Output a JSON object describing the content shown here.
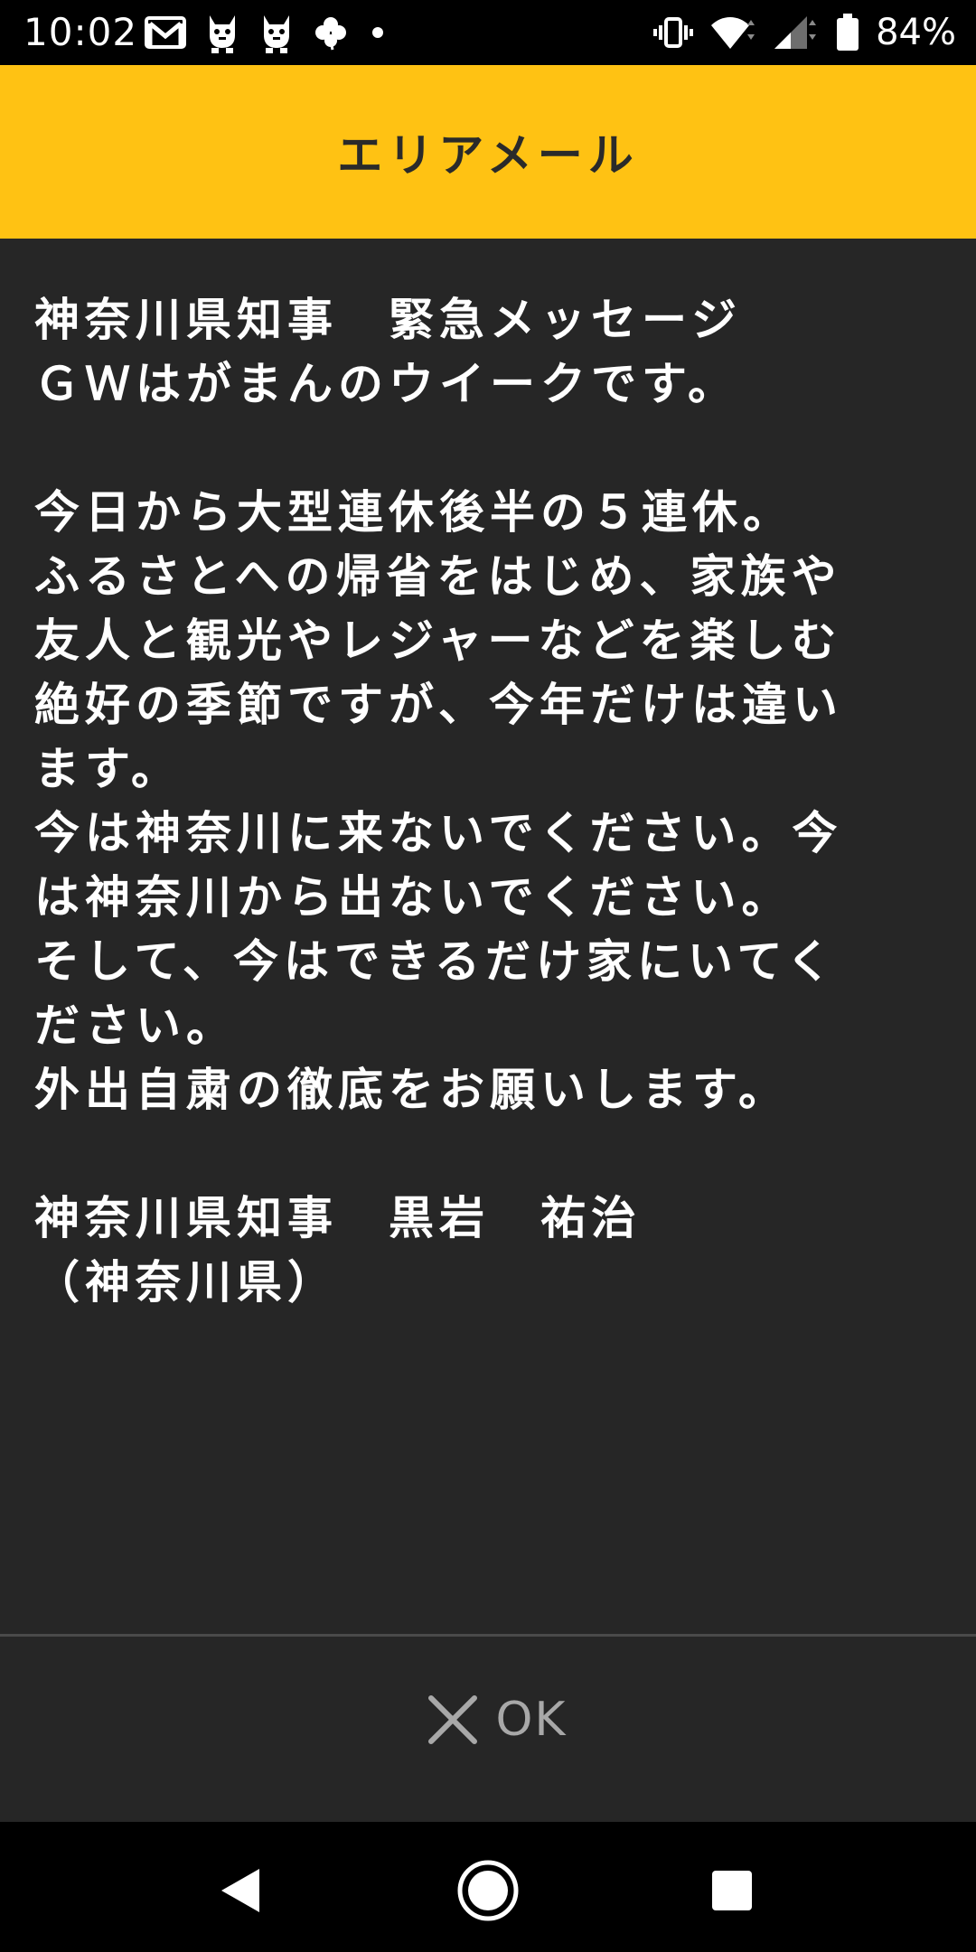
{
  "status_bar": {
    "time": "10:02",
    "left_icons": [
      "gmail-icon",
      "mascot-icon",
      "mascot-icon",
      "clover-icon",
      "dot-icon"
    ],
    "right_icons": [
      "vibrate-icon",
      "wifi-icon",
      "signal-icon",
      "battery-icon"
    ],
    "battery_percent": "84%"
  },
  "header": {
    "title": "エリアメール",
    "background_color": "#ffc213"
  },
  "message": {
    "body": "神奈川県知事　緊急メッセージ\nＧＷはがまんのウイークです。\n\n今日から大型連休後半の５連休。\nふるさとへの帰省をはじめ、家族や\n友人と観光やレジャーなどを楽しむ\n絶好の季節ですが、今年だけは違い\nます。\n今は神奈川に来ないでください。今\nは神奈川から出ないでください。\nそして、今はできるだけ家にいてく\nださい。\n外出自粛の徹底をお願いします。\n\n神奈川県知事　黒岩　祐治\n（神奈川県）"
  },
  "ok_button": {
    "icon": "close-icon",
    "label": "OK"
  },
  "nav_bar": {
    "buttons": [
      "back-icon",
      "home-icon",
      "recents-icon"
    ]
  }
}
